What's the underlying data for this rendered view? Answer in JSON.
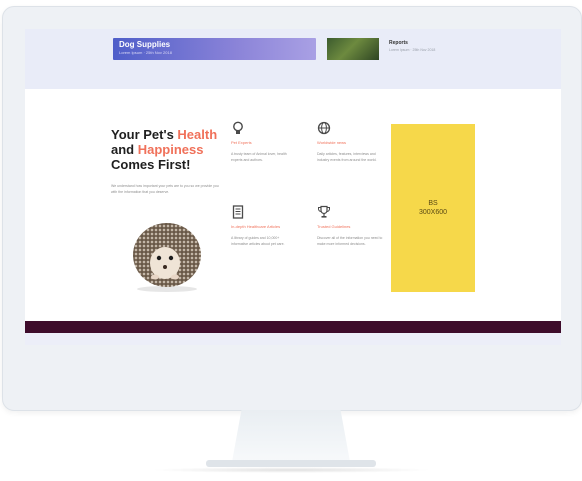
{
  "top_banner": {
    "title": "Dog Supplies",
    "meta": "Lorem Ipsum · 25th Nov 2018"
  },
  "top_post": {
    "title": "Reports",
    "meta": "Lorem Ipsum · 25th Nov 2018"
  },
  "hero": {
    "headline_part1": "Your Pet's ",
    "headline_highlight1": "Health",
    "headline_part2": " and ",
    "headline_highlight2": "Happiness",
    "headline_part3": " Comes First!",
    "blurb": "We understand how important your pets are to you so we provide you with the information that you deserve."
  },
  "features": [
    {
      "icon": "lightbulb-icon",
      "title": "Pet Experts",
      "text": "A trusty team of Animal lover, health experts and authors."
    },
    {
      "icon": "globe-icon",
      "title": "Worldwide news",
      "text": "Daily articles, features, interviews and industry events from around the world."
    },
    {
      "icon": "document-icon",
      "title": "In-depth Healthcare Articles",
      "text": "A library of guides and 10,000+ informative articles about pet care."
    },
    {
      "icon": "trophy-icon",
      "title": "Trusted Guidelines",
      "text": "Discover all of the information you need to make more informed decisions."
    }
  ],
  "ad": {
    "line1": "BS",
    "line2": "300X600"
  },
  "colors": {
    "accent": "#f0715a",
    "ad_background": "#f6d84a",
    "footer_bar": "#3e0c2b"
  }
}
